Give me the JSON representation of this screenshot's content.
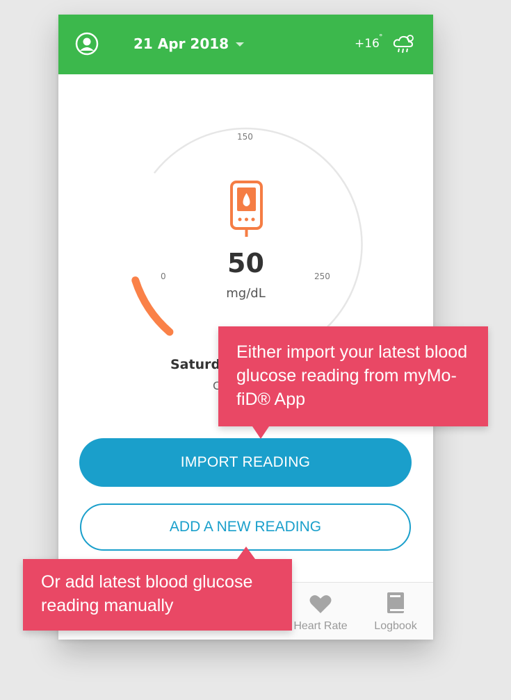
{
  "header": {
    "date": "21 Apr 2018",
    "temperature": "+16",
    "degree_symbol": "°",
    "weather_icon": "cloud-rain-sun-icon",
    "bar_color": "#3cb84c"
  },
  "gauge": {
    "value": "50",
    "unit": "mg/dL",
    "min_label": "0",
    "mid_label": "150",
    "max_label": "250",
    "min": 0,
    "max": 250,
    "current": 50,
    "indicator_color": "#fa8148",
    "device_icon": "glucose-meter-icon"
  },
  "reading_info": {
    "day_partial": "Saturd",
    "sub_partial": "C"
  },
  "actions": {
    "import_label": "IMPORT  READING",
    "add_label": "ADD A NEW READING",
    "accent_color": "#1a9fcb"
  },
  "bottom_nav": {
    "items": [
      {
        "label": "Heart Rate",
        "icon": "heart-icon"
      },
      {
        "label": "Logbook",
        "icon": "book-icon"
      }
    ]
  },
  "callouts": {
    "import_tip": "Either import your latest blood glucose reading from myMo-fiD® App",
    "manual_tip": "Or add latest blood glucose reading manually",
    "color": "#e94865"
  }
}
